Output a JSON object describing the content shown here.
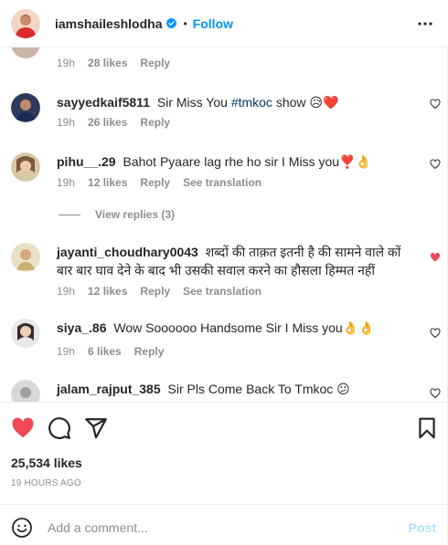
{
  "header": {
    "username": "iamshaileshlodha",
    "separator": "•",
    "follow_label": "Follow"
  },
  "comments": [
    {
      "username": "",
      "text": "",
      "time": "19h",
      "likes": "28 likes",
      "reply": "Reply",
      "liked": false
    },
    {
      "username": "sayyedkaif5811",
      "text_before": "Sir Miss You ",
      "hashtag": "#tmkoc",
      "text_after": " show 😥❤️",
      "time": "19h",
      "likes": "26 likes",
      "reply": "Reply",
      "liked": false
    },
    {
      "username": "pihu__.29",
      "text": "Bahot Pyaare lag rhe ho sir I Miss you❣️👌",
      "time": "19h",
      "likes": "12 likes",
      "reply": "Reply",
      "translation": "See translation",
      "view_replies": "View replies (3)",
      "liked": false
    },
    {
      "username": "jayanti_choudhary0043",
      "text": "शब्दों की ताक़त इतनी है की सामने वाले कों बार बार घाव देने के बाद भी उसकी सवाल करने का हौसला हिम्मत नहीं",
      "time": "19h",
      "likes": "12 likes",
      "reply": "Reply",
      "translation": "See translation",
      "liked": true
    },
    {
      "username": "siya_.86",
      "text": "Wow Soooooo Handsome Sir I Miss you👌👌",
      "time": "19h",
      "likes": "6 likes",
      "reply": "Reply",
      "liked": false
    },
    {
      "username": "jalam_rajput_385",
      "text": "Sir Pls Come Back To Tmkoc 😕",
      "liked": false
    }
  ],
  "post": {
    "likes": "25,534 likes",
    "time_ago": "19 HOURS AGO",
    "liked": true
  },
  "add_comment": {
    "placeholder": "Add a comment...",
    "post_label": "Post"
  },
  "colors": {
    "accent": "#0095f6",
    "heart": "#ed4956",
    "muted": "#8e8e8e",
    "post_disabled": "#b2dffc"
  }
}
